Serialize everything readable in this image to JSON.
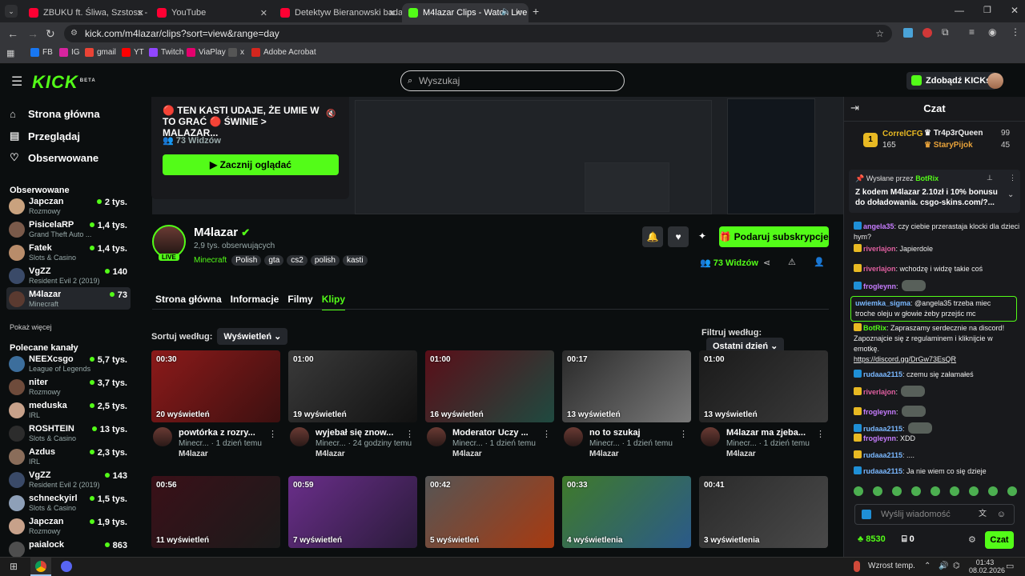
{
  "browser": {
    "tabs": [
      {
        "title": "ZBUKU ft. Śliwa, Szstoss - Młoda"
      },
      {
        "title": "YouTube"
      },
      {
        "title": "Detektyw Bieranowski bada spra"
      },
      {
        "title": "M4lazar Clips - Watch Live o"
      }
    ],
    "url": "kick.com/m4lazar/clips?sort=view&range=day",
    "bookmarks": [
      "FB",
      "IG",
      "gmail",
      "YT",
      "Twitch",
      "ViaPlay",
      "x",
      "Adobe Acrobat"
    ]
  },
  "header": {
    "logo": "KICK",
    "logo_sup": "BETA",
    "search_placeholder": "Wyszukaj",
    "get_kicks": "Zdobądź KICKs"
  },
  "sidebar": {
    "nav": [
      "Strona główna",
      "Przeglądaj",
      "Obserwowane"
    ],
    "followed_title": "Obserwowane",
    "followed": [
      {
        "name": "Japczan",
        "category": "Rozmowy",
        "viewers": "2 tys."
      },
      {
        "name": "PisicelaRP",
        "category": "Grand Theft Auto ...",
        "viewers": "1,4 tys."
      },
      {
        "name": "Fatek",
        "category": "Slots & Casino",
        "viewers": "1,4 tys."
      },
      {
        "name": "VgZZ",
        "category": "Resident Evil 2 (2019)",
        "viewers": "140"
      },
      {
        "name": "M4lazar",
        "category": "Minecraft",
        "viewers": "73"
      }
    ],
    "show_more": "Pokaż więcej",
    "recommended_title": "Polecane kanały",
    "recommended": [
      {
        "name": "NEEXcsgo",
        "category": "League of Legends",
        "viewers": "5,7 tys."
      },
      {
        "name": "niter",
        "category": "Rozmowy",
        "viewers": "3,7 tys."
      },
      {
        "name": "meduska",
        "category": "IRL",
        "viewers": "2,5 tys."
      },
      {
        "name": "ROSHTEIN",
        "category": "Slots & Casino",
        "viewers": "13 tys."
      },
      {
        "name": "Azdus",
        "category": "IRL",
        "viewers": "2,3 tys."
      },
      {
        "name": "VgZZ",
        "category": "Resident Evil 2 (2019)",
        "viewers": "143"
      },
      {
        "name": "schneckyirl",
        "category": "Slots & Casino",
        "viewers": "1,5 tys."
      },
      {
        "name": "Japczan",
        "category": "Rozmowy",
        "viewers": "1,9 tys."
      },
      {
        "name": "paialock",
        "category": "",
        "viewers": "863"
      }
    ]
  },
  "stream_card": {
    "title": "🔴 TEN KASTI UDAJE, ŻE UMIE W TO GRAĆ 🔴 ŚWINIE > MALAZAR...",
    "viewers": "73 Widzów",
    "watch_label": "Zacznij oglądać"
  },
  "channel": {
    "name": "M4lazar",
    "followers": "2,9 tys. obserwujących",
    "category": "Minecraft",
    "tags": [
      "Polish",
      "gta",
      "cs2",
      "polish",
      "kasti"
    ],
    "live_badge": "LIVE",
    "subscribe_label": "Podaruj subskrypcje",
    "viewers": "73 Widzów",
    "tabs": [
      "Strona główna",
      "Informacje",
      "Filmy",
      "Klipy"
    ],
    "active_tab": "Klipy"
  },
  "clips_controls": {
    "sort_label": "Sortuj według:",
    "sort_value": "Wyświetleń",
    "filter_label": "Filtruj według:",
    "filter_value": "Ostatni dzień"
  },
  "clips": [
    {
      "duration": "00:30",
      "views": "20 wyświetleń",
      "title": "powtórka z rozry...",
      "meta": "Minecr... · 1 dzień temu",
      "author": "M4lazar"
    },
    {
      "duration": "01:00",
      "views": "19 wyświetleń",
      "title": "wyjebał się znow...",
      "meta": "Minecr... · 24 godziny temu",
      "author": "M4lazar"
    },
    {
      "duration": "01:00",
      "views": "16 wyświetleń",
      "title": "Moderator Uczy ...",
      "meta": "Minecr... · 1 dzień temu",
      "author": "M4lazar"
    },
    {
      "duration": "00:17",
      "views": "13 wyświetleń",
      "title": "no to szukaj",
      "meta": "Minecr... · 1 dzień temu",
      "author": "M4lazar"
    },
    {
      "duration": "01:00",
      "views": "13 wyświetleń",
      "title": "M4lazar ma zjeba...",
      "meta": "Minecr... · 1 dzień temu",
      "author": "M4lazar"
    },
    {
      "duration": "00:56",
      "views": "11 wyświetleń"
    },
    {
      "duration": "00:59",
      "views": "7 wyświetleń"
    },
    {
      "duration": "00:42",
      "views": "5 wyświetleń"
    },
    {
      "duration": "00:33",
      "views": "4 wyświetlenia"
    },
    {
      "duration": "00:41",
      "views": "3 wyświetlenia"
    }
  ],
  "chat": {
    "title": "Czat",
    "leaderboard": [
      {
        "name": "CorrelCFG",
        "value": "165"
      },
      {
        "name": "Tr4p3rQueen",
        "value": "99"
      },
      {
        "name": "StaryPijok",
        "value": "45"
      }
    ],
    "pinned_by": "Wysłane przez",
    "pinned_user": "BotRix",
    "pinned_text": "Z kodem M4lazar 2.10zł i 10% bonusu do doładowania. csgo-skins.com/?...",
    "messages": [
      {
        "user": "angela35",
        "text": ": czy ciebie przerastaja klocki dla dzieci hym?"
      },
      {
        "user": "riverlajon",
        "text": ": Japierdole"
      },
      {
        "user": "riverlajon",
        "text": ": wchodzę i widzę takie coś"
      },
      {
        "user": "frogleynn",
        "text": ":"
      },
      {
        "user": "uwiemka_sigma",
        "text": ": @angela35 trzeba miec troche oleju w głowie żeby przejśc mc"
      },
      {
        "user": "BotRix",
        "text": ": Zapraszamy serdecznie na discord! Zapoznajcie się z regulaminem i kliknijcie w emotkę.",
        "link": "https://discord.gg/DrGw73EsQR"
      },
      {
        "user": "rudaaa2115",
        "text": ": czemu się załamałeś"
      },
      {
        "user": "riverlajon",
        "text": ":"
      },
      {
        "user": "frogleynn",
        "text": ":"
      },
      {
        "user": "rudaaa2115",
        "text": ":"
      },
      {
        "user": "frogleynn",
        "text": ": XDD"
      },
      {
        "user": "rudaaa2115",
        "text": ": ...."
      },
      {
        "user": "rudaaa2115",
        "text": ": Ja nie wiem co się dzieje"
      }
    ],
    "input_placeholder": "Wyślij wiadomość",
    "points": "8530",
    "gifts": "0",
    "send_label": "Czat"
  },
  "taskbar": {
    "weather": "Wzrost temp.",
    "time": "01:43",
    "date": "08.02.2026"
  }
}
